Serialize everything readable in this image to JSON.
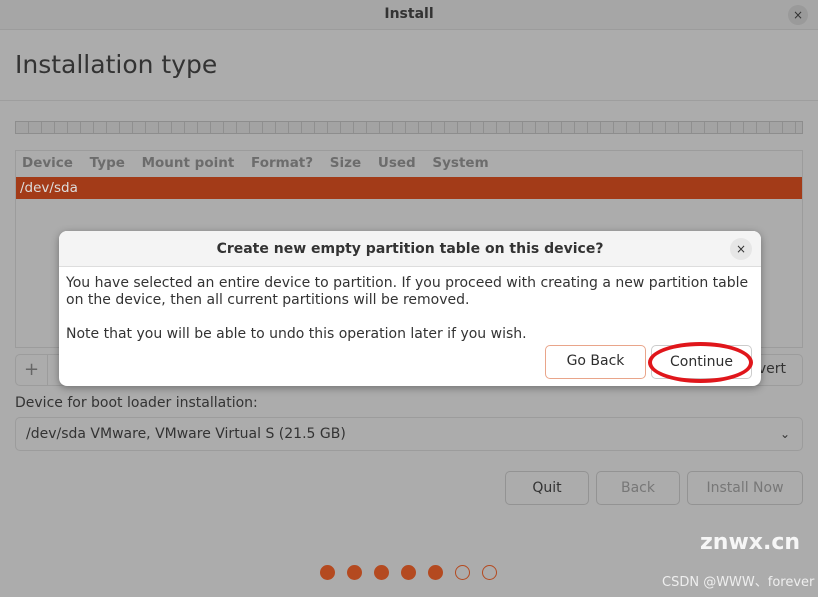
{
  "window": {
    "title": "Install",
    "close": "×"
  },
  "page": {
    "heading": "Installation type"
  },
  "table": {
    "columns": [
      "Device",
      "Type",
      "Mount point",
      "Format?",
      "Size",
      "Used",
      "System"
    ],
    "rows": [
      {
        "device": "/dev/sda"
      }
    ]
  },
  "toolbar": {
    "add": "+",
    "revert": "Revert"
  },
  "boot": {
    "label": "Device for boot loader installation:",
    "value": "/dev/sda VMware, VMware Virtual S (21.5 GB)",
    "chevron": "⌄"
  },
  "buttons": {
    "quit": "Quit",
    "back": "Back",
    "install": "Install Now"
  },
  "progress": {
    "total": 7,
    "completed": 5,
    "color": "#b44a20"
  },
  "dialog": {
    "title": "Create new empty partition table on this device?",
    "close": "×",
    "message": "You have selected an entire device to partition. If you proceed with creating a new partition table on the device, then all current partitions will be removed.",
    "note": "Note that you will be able to undo this operation later if you wish.",
    "go_back": "Go Back",
    "continue": "Continue"
  },
  "watermark": {
    "site": "znwx.cn",
    "author": "CSDN @WWW、forever"
  },
  "colors": {
    "accent": "#a33b18",
    "highlight_ring": "#e0161b"
  }
}
